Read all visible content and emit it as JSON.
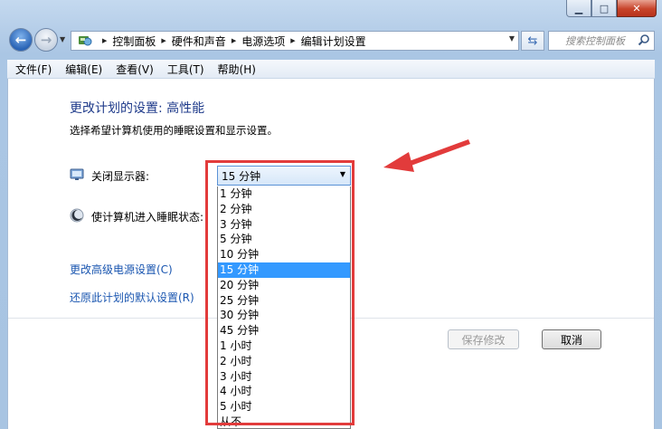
{
  "breadcrumb": [
    "控制面板",
    "硬件和声音",
    "电源选项",
    "编辑计划设置"
  ],
  "search": {
    "placeholder": "搜索控制面板"
  },
  "menu": [
    "文件(F)",
    "编辑(E)",
    "查看(V)",
    "工具(T)",
    "帮助(H)"
  ],
  "page": {
    "title": "更改计划的设置: 高性能",
    "subtitle": "选择希望计算机使用的睡眠设置和显示设置。"
  },
  "display_off": {
    "label": "关闭显示器:",
    "selected": "15 分钟"
  },
  "sleep": {
    "label": "使计算机进入睡眠状态:"
  },
  "dropdown_options": [
    "1 分钟",
    "2 分钟",
    "3 分钟",
    "5 分钟",
    "10 分钟",
    "15 分钟",
    "20 分钟",
    "25 分钟",
    "30 分钟",
    "45 分钟",
    "1 小时",
    "2 小时",
    "3 小时",
    "4 小时",
    "5 小时",
    "从不"
  ],
  "dropdown_selected_index": 5,
  "links": {
    "advanced": "更改高级电源设置(C)",
    "restore": "还原此计划的默认设置(R)"
  },
  "buttons": {
    "save": "保存修改",
    "cancel": "取消"
  },
  "colors": {
    "annotation": "#e23b3b",
    "selection": "#3399ff",
    "link": "#1a56b0"
  },
  "icons": [
    "back-arrow-icon",
    "forward-arrow-icon",
    "control-panel-icon",
    "refresh-icon",
    "search-icon",
    "display-icon",
    "sleep-moon-icon",
    "minimize-icon",
    "maximize-icon",
    "close-icon"
  ]
}
